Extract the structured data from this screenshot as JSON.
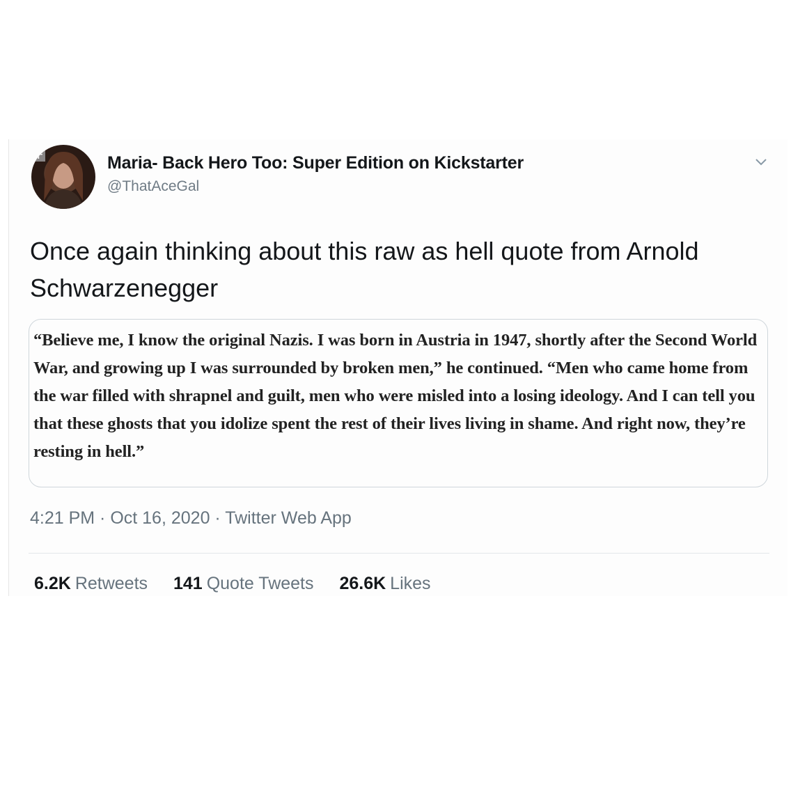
{
  "user": {
    "display_name": "Maria- Back Hero Too: Super Edition on Kickstarter",
    "handle": "@ThatAceGal"
  },
  "tweet": {
    "text": "Once again thinking about this raw as hell quote from Arnold Schwarzenegger",
    "quote": "“Believe me, I know the original Nazis. I was born in Austria in 1947, shortly after the Second World War, and growing up I was surrounded by broken men,” he continued. “Men who came home from the war filled with shrapnel and guilt, men who were misled into a losing ideology. And I can tell you that these ghosts that you idolize spent the rest of their lives living in shame. And right now, they’re resting in hell.”",
    "timestamp": "4:21 PM · Oct 16, 2020 · Twitter Web App"
  },
  "stats": [
    {
      "count": "6.2K",
      "label": "Retweets"
    },
    {
      "count": "141",
      "label": "Quote Tweets"
    },
    {
      "count": "26.6K",
      "label": "Likes"
    }
  ],
  "icons": {
    "caret": "chevron-down-icon",
    "avatar": "avatar"
  }
}
